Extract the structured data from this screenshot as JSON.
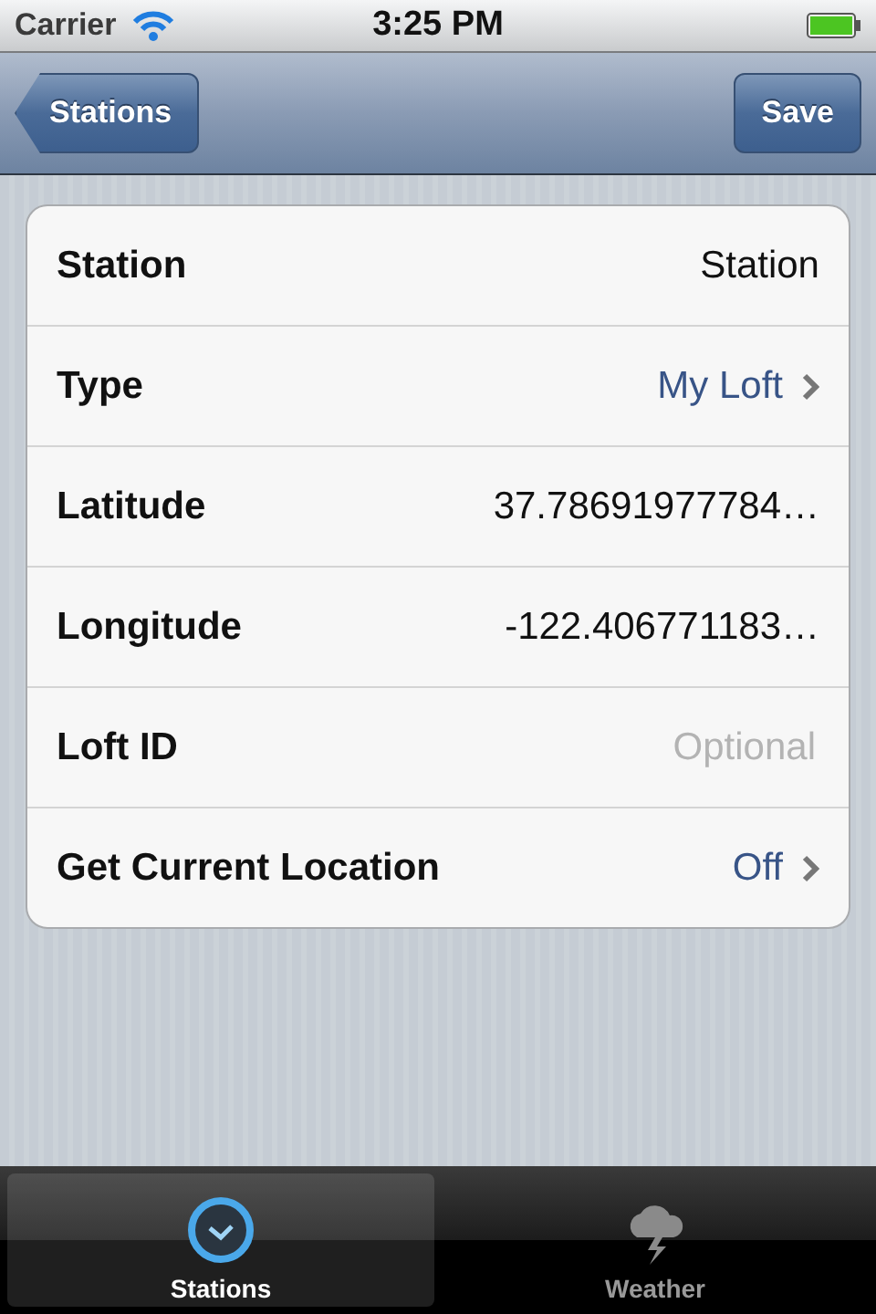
{
  "status_bar": {
    "carrier": "Carrier",
    "time": "3:25 PM"
  },
  "nav_bar": {
    "back": "Stations",
    "action": "Save"
  },
  "rows": [
    {
      "label": "Station",
      "kind": "value",
      "value": "Station"
    },
    {
      "label": "Type",
      "kind": "link",
      "value": "My Loft"
    },
    {
      "label": "Latitude",
      "kind": "value",
      "value": "37.78691977784…"
    },
    {
      "label": "Longitude",
      "kind": "value",
      "value": "-122.406771183…"
    },
    {
      "label": "Loft ID",
      "kind": "field",
      "placeholder": "Optional"
    },
    {
      "label": "Get Current Location",
      "kind": "link",
      "value": "Off"
    }
  ],
  "tabs": [
    {
      "label": "Stations",
      "kind": "clock",
      "selected": true
    },
    {
      "label": "Weather",
      "kind": "cloud",
      "selected": false
    }
  ]
}
